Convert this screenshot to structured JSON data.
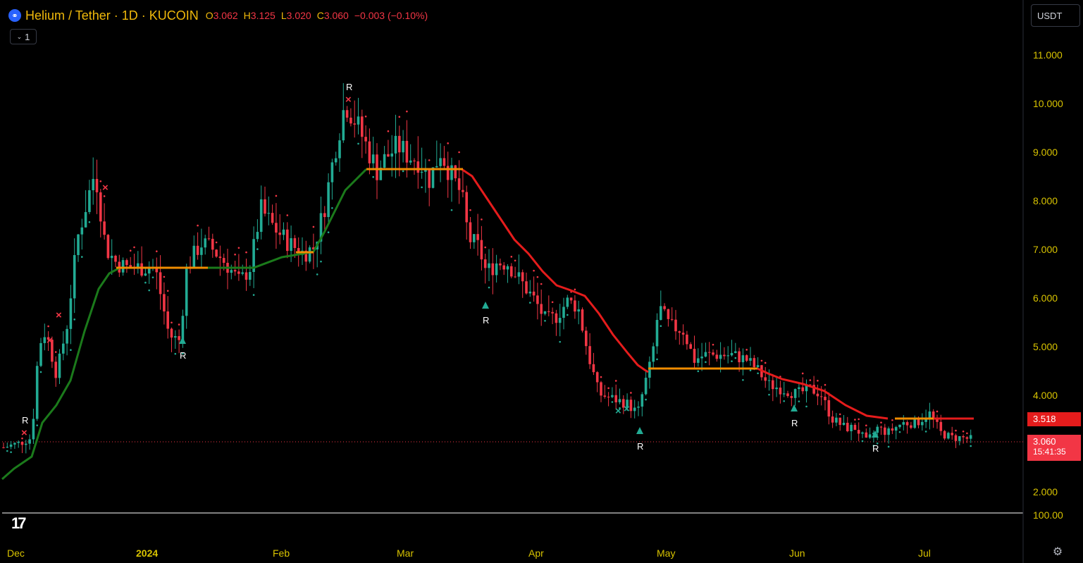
{
  "header": {
    "logo_icon": "helium-logo-icon",
    "symbol": "Helium / Tether · 1D · KUCOIN",
    "ohlc": [
      {
        "k": "O",
        "v": "3.062"
      },
      {
        "k": "H",
        "v": "3.125"
      },
      {
        "k": "L",
        "v": "3.020"
      },
      {
        "k": "C",
        "v": "3.060"
      }
    ],
    "change": "−0.003 (−0.10%)"
  },
  "legend_toggle": {
    "label": "1",
    "icon": "chevron-down-icon"
  },
  "currency_button": {
    "label": "USDT"
  },
  "price_tags": {
    "supertrend": "3.518",
    "last": "3.060",
    "countdown": "15:41:35"
  },
  "colors": {
    "up": "#22ab94",
    "down": "#f23645",
    "trend_up": "#1b7a1b",
    "trend_down": "#e51c1c",
    "flat": "#f08c00",
    "axis_text": "#d8c300"
  },
  "chart_data": {
    "type": "candlestick",
    "y_ticks": [
      "11.000",
      "10.000",
      "9.000",
      "8.000",
      "7.000",
      "6.000",
      "5.000",
      "4.000",
      "2.000"
    ],
    "x_labels": [
      "Dec",
      "2024",
      "Feb",
      "Mar",
      "Apr",
      "May",
      "Jun",
      "Jul"
    ],
    "volume_tick": "100.00",
    "ylim": [
      1.6,
      11.8
    ],
    "signal_label": "R"
  }
}
